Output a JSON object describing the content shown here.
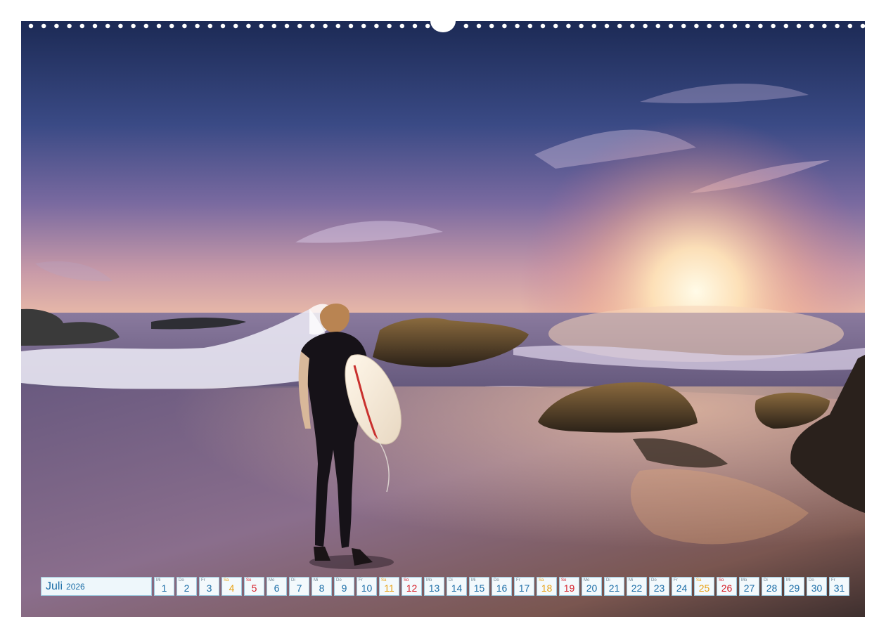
{
  "calendar": {
    "month": "Juli",
    "year": "2026",
    "days": [
      {
        "wd": "Mi",
        "d": "1",
        "type": "weekday"
      },
      {
        "wd": "Do",
        "d": "2",
        "type": "weekday"
      },
      {
        "wd": "Fr",
        "d": "3",
        "type": "weekday"
      },
      {
        "wd": "Sa",
        "d": "4",
        "type": "sat"
      },
      {
        "wd": "So",
        "d": "5",
        "type": "sun"
      },
      {
        "wd": "Mo",
        "d": "6",
        "type": "weekday"
      },
      {
        "wd": "Di",
        "d": "7",
        "type": "weekday"
      },
      {
        "wd": "Mi",
        "d": "8",
        "type": "weekday"
      },
      {
        "wd": "Do",
        "d": "9",
        "type": "weekday"
      },
      {
        "wd": "Fr",
        "d": "10",
        "type": "weekday"
      },
      {
        "wd": "Sa",
        "d": "11",
        "type": "sat"
      },
      {
        "wd": "So",
        "d": "12",
        "type": "sun"
      },
      {
        "wd": "Mo",
        "d": "13",
        "type": "weekday"
      },
      {
        "wd": "Di",
        "d": "14",
        "type": "weekday"
      },
      {
        "wd": "Mi",
        "d": "15",
        "type": "weekday"
      },
      {
        "wd": "Do",
        "d": "16",
        "type": "weekday"
      },
      {
        "wd": "Fr",
        "d": "17",
        "type": "weekday"
      },
      {
        "wd": "Sa",
        "d": "18",
        "type": "sat"
      },
      {
        "wd": "So",
        "d": "19",
        "type": "sun"
      },
      {
        "wd": "Mo",
        "d": "20",
        "type": "weekday"
      },
      {
        "wd": "Di",
        "d": "21",
        "type": "weekday"
      },
      {
        "wd": "Mi",
        "d": "22",
        "type": "weekday"
      },
      {
        "wd": "Do",
        "d": "23",
        "type": "weekday"
      },
      {
        "wd": "Fr",
        "d": "24",
        "type": "weekday"
      },
      {
        "wd": "Sa",
        "d": "25",
        "type": "sat"
      },
      {
        "wd": "So",
        "d": "26",
        "type": "sun"
      },
      {
        "wd": "Mo",
        "d": "27",
        "type": "weekday"
      },
      {
        "wd": "Di",
        "d": "28",
        "type": "weekday"
      },
      {
        "wd": "Mi",
        "d": "29",
        "type": "weekday"
      },
      {
        "wd": "Do",
        "d": "30",
        "type": "weekday"
      },
      {
        "wd": "Fr",
        "d": "31",
        "type": "weekday"
      }
    ]
  },
  "colors": {
    "weekday": "#1e6fa8",
    "saturday": "#e8a317",
    "sunday": "#d6202a",
    "cell_background": "#f3f9fc",
    "cell_border": "#9cc7dc"
  },
  "photo_icons": [
    "surfer-figure-icon",
    "surfboard-icon",
    "sun-icon",
    "wave-icon",
    "rock-icon"
  ]
}
